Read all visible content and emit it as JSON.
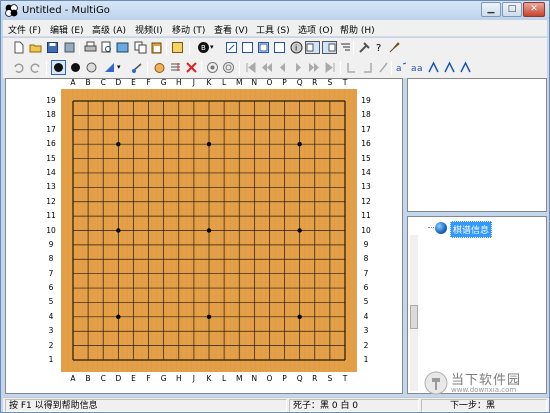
{
  "window": {
    "title": "Untitled - MultiGo"
  },
  "menu": {
    "items": [
      "文件 (F)",
      "编辑 (E)",
      "高级 (A)",
      "视频(I)",
      "移动 (T)",
      "查看 (V)",
      "工具 (S)",
      "选项 (O)",
      "帮助 (H)"
    ]
  },
  "toolbar1": {
    "icons": [
      "new-file-icon",
      "open-folder-icon",
      "save-icon",
      "save-as-icon",
      "print-icon",
      "print-preview-icon",
      "image-export-icon",
      "copy-icon",
      "paste-icon",
      "properties-icon",
      "stone-color-icon",
      "board-icon",
      "grid-icon",
      "pane-icon",
      "pane2-icon",
      "info-icon",
      "layout1-icon",
      "layout2-icon",
      "tree-icon",
      "tools-icon",
      "help-icon",
      "brush-icon"
    ]
  },
  "toolbar2": {
    "icons": [
      "undo-icon",
      "redo-icon",
      "black-stone-icon",
      "black-circle-icon",
      "gray-circle-icon",
      "mark-icon",
      "triangle-icon",
      "hand-icon",
      "insert-icon",
      "delete-icon",
      "pass-icon",
      "circle-icon",
      "first-icon",
      "back-fast-icon",
      "back-icon",
      "forward-icon",
      "forward-fast-icon",
      "last-icon",
      "var-prev-icon",
      "var-next-icon",
      "var-first-icon",
      "var-last-icon",
      "find-icon",
      "find-next-icon",
      "find-prev-icon",
      "find-all-icon"
    ]
  },
  "board": {
    "columns": [
      "A",
      "B",
      "C",
      "D",
      "E",
      "F",
      "G",
      "H",
      "J",
      "K",
      "L",
      "M",
      "N",
      "O",
      "P",
      "Q",
      "R",
      "S",
      "T"
    ],
    "rows": [
      "19",
      "18",
      "17",
      "16",
      "15",
      "14",
      "13",
      "12",
      "11",
      "10",
      "9",
      "8",
      "7",
      "6",
      "5",
      "4",
      "3",
      "2",
      "1"
    ],
    "size": 19,
    "colors": {
      "wood": "#e3a048",
      "line": "#2b1a08",
      "hoshi": "#000000"
    }
  },
  "tree": {
    "root_label": "棋谱信息"
  },
  "status": {
    "help": "按 F1 以得到帮助信息",
    "captures": "死子：黑 0 白 0",
    "next_move": "下一步：黑"
  },
  "watermark": {
    "text": "当下软件园",
    "sub": "www.downxia.com"
  }
}
